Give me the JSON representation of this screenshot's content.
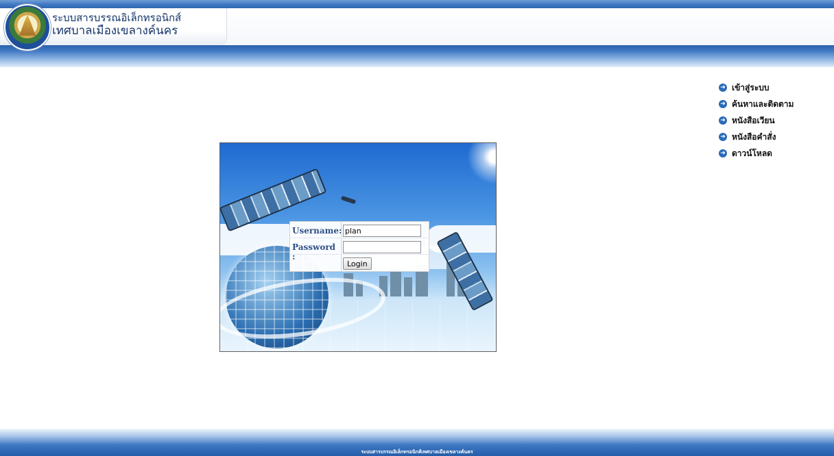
{
  "header": {
    "title_line1": "ระบบสารบรรณอิเล็กทรอนิกส์",
    "title_line2": "เทศบาลเมืองเขลางค์นคร"
  },
  "menu": {
    "items": [
      {
        "label": "เข้าสู่ระบบ"
      },
      {
        "label": "ค้นหาและติดตาม"
      },
      {
        "label": "หนังสือเวียน"
      },
      {
        "label": "หนังสือคำสั่ง"
      },
      {
        "label": "ดาวน์โหลด"
      }
    ]
  },
  "login": {
    "username_label": "Username:",
    "username_value": "plan",
    "password_label": "Password :",
    "password_value": "",
    "login_button": "Login"
  },
  "footer": {
    "text": "ระบบสารบรรณอิเล็กทรอนิกส์เทศบาลเมืองเขลางค์นคร"
  },
  "colors": {
    "header_blue": "#2f66b0",
    "title_text": "#15356b",
    "menu_arrow": "#2a6ab8",
    "login_label": "#2f4f86"
  },
  "icons": {
    "menu_bullet": "arrow-circle-right-icon",
    "logo": "municipality-seal-logo"
  }
}
